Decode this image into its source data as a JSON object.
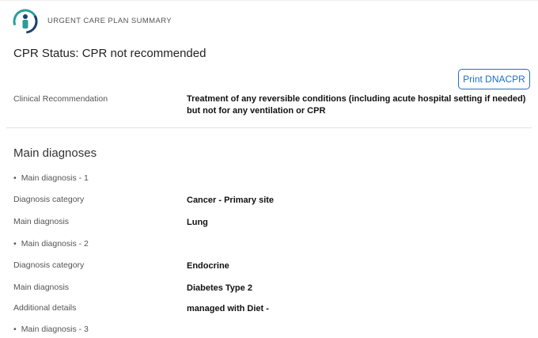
{
  "header": {
    "title": "URGENT CARE PLAN SUMMARY"
  },
  "cpr_status": "CPR Status: CPR not recommended",
  "print_button": "Print DNACPR",
  "clinical": {
    "label": "Clinical Recommendation",
    "value": "Treatment of any reversible conditions (including acute hospital setting if needed) but not for any ventilation or CPR"
  },
  "diagnoses": {
    "section_title": "Main diagnoses",
    "bullet_char": "•",
    "items": [
      {
        "heading": "Main diagnosis - 1",
        "rows": [
          {
            "label": "Diagnosis category",
            "value": "Cancer - Primary site"
          },
          {
            "label": "Main diagnosis",
            "value": "Lung"
          }
        ]
      },
      {
        "heading": "Main diagnosis - 2",
        "rows": [
          {
            "label": "Diagnosis category",
            "value": "Endocrine"
          },
          {
            "label": "Main diagnosis",
            "value": "Diabetes Type 2"
          },
          {
            "label": "Additional details",
            "value": "managed with Diet -"
          }
        ]
      },
      {
        "heading": "Main diagnosis - 3",
        "rows": []
      }
    ]
  },
  "colors": {
    "accent": "#1e6fc8",
    "logo_teal": "#2a9d9b",
    "logo_navy": "#1f3f6e"
  }
}
